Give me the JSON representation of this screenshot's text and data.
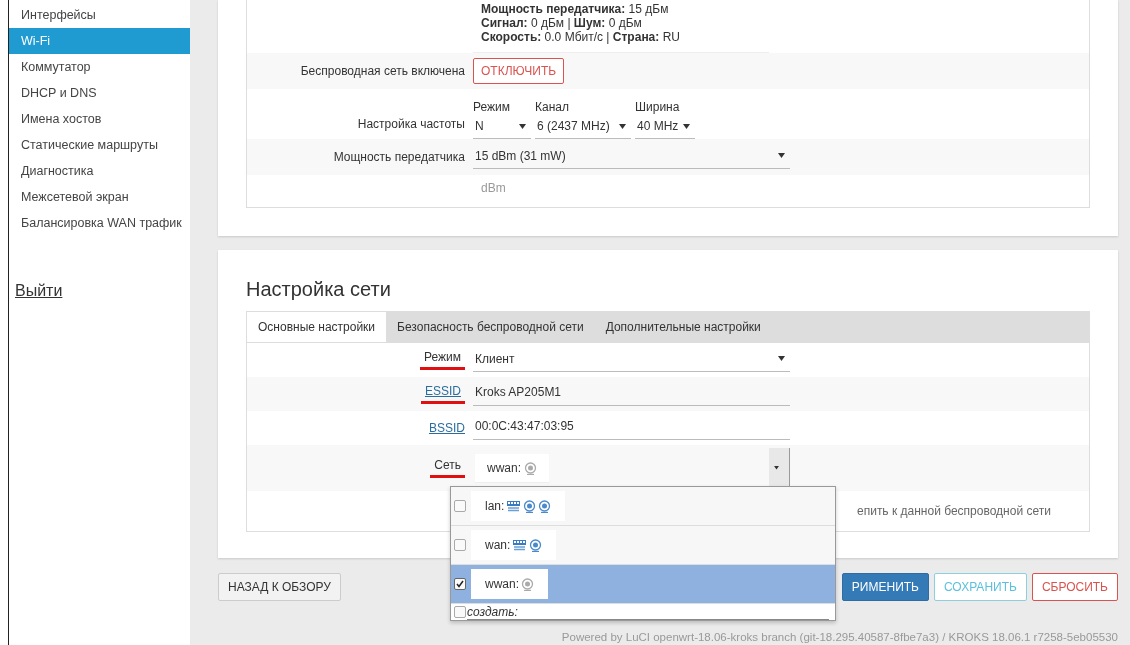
{
  "sidebar": {
    "items": [
      {
        "label": "Интерфейсы",
        "selected": false
      },
      {
        "label": "Wi-Fi",
        "selected": true
      },
      {
        "label": "Коммутатор",
        "selected": false
      },
      {
        "label": "DHCP и DNS",
        "selected": false
      },
      {
        "label": "Имена хостов",
        "selected": false
      },
      {
        "label": "Статические маршруты",
        "selected": false
      },
      {
        "label": "Диагностика",
        "selected": false
      },
      {
        "label": "Межсетевой экран",
        "selected": false
      },
      {
        "label": "Балансировка WAN трафик",
        "selected": false
      }
    ],
    "logout": "Выйти"
  },
  "device_section": {
    "info_lines": [
      "**Мощность передатчика:** 15 дБм",
      "**Сигнал:** 0 дБм | **Шум:** 0 дБм",
      "**Скорость:** 0.0 Мбит/с | **Страна:** RU"
    ],
    "enabled_row": {
      "label": "Беспроводная сеть включена",
      "button": "ОТКЛЮЧИТЬ"
    },
    "frequency": {
      "label": "Настройка частоты",
      "selects": [
        {
          "caption": "Режим",
          "value": "N"
        },
        {
          "caption": "Канал",
          "value": "6 (2437 MHz)"
        },
        {
          "caption": "Ширина",
          "value": "40 MHz"
        }
      ]
    },
    "tx_power": {
      "label": "Мощность передатчика",
      "value": "15 dBm (31 mW)",
      "hint": "dBm"
    }
  },
  "network_section": {
    "title": "Настройка сети",
    "tabs": [
      {
        "label": "Основные настройки",
        "selected": true
      },
      {
        "label": "Безопасность беспроводной сети",
        "selected": false
      },
      {
        "label": "Дополнительные настройки",
        "selected": false
      }
    ],
    "fields": [
      {
        "kind": "select",
        "label": "Режим",
        "link": false,
        "marked": true,
        "value": "Клиент"
      },
      {
        "kind": "text",
        "label": "ESSID",
        "link": true,
        "marked": true,
        "value": "Kroks AP205M1"
      },
      {
        "kind": "text",
        "label": "BSSID",
        "link": true,
        "marked": false,
        "value": "00:0C:43:47:03:95"
      },
      {
        "kind": "networks",
        "label": "Сеть",
        "link": false,
        "marked": true,
        "value": "wwan:",
        "icons": [
          {
            "kind": "wireless-off"
          }
        ]
      }
    ],
    "description": "епить к данной беспроводной сети",
    "dropdown": {
      "options": [
        {
          "label": "lan:",
          "icons": [
            {
              "kind": "ethernet"
            },
            {
              "kind": "wireless"
            },
            {
              "kind": "wireless"
            }
          ],
          "selected": false
        },
        {
          "label": "wan:",
          "icons": [
            {
              "kind": "ethernet"
            },
            {
              "kind": "wireless"
            }
          ],
          "selected": false
        },
        {
          "label": "wwan:",
          "icons": [
            {
              "kind": "wireless-off"
            }
          ],
          "selected": true
        }
      ],
      "create_label": "создать:",
      "create_checked": false
    }
  },
  "buttons": [
    {
      "label": "НАЗАД К ОБЗОРУ",
      "kind": "default"
    },
    {
      "label": "РИМЕНИТЬ",
      "kind": "primary"
    },
    {
      "label": "СОХРАНИТЬ",
      "kind": "save"
    },
    {
      "label": "СБРОСИТЬ",
      "kind": "reset"
    }
  ],
  "footer": "Powered by LuCI openwrt-18.06-kroks branch (git-18.295.40587-8fbe7a3) / KROKS 18.06.1 r7258-5eb05530"
}
